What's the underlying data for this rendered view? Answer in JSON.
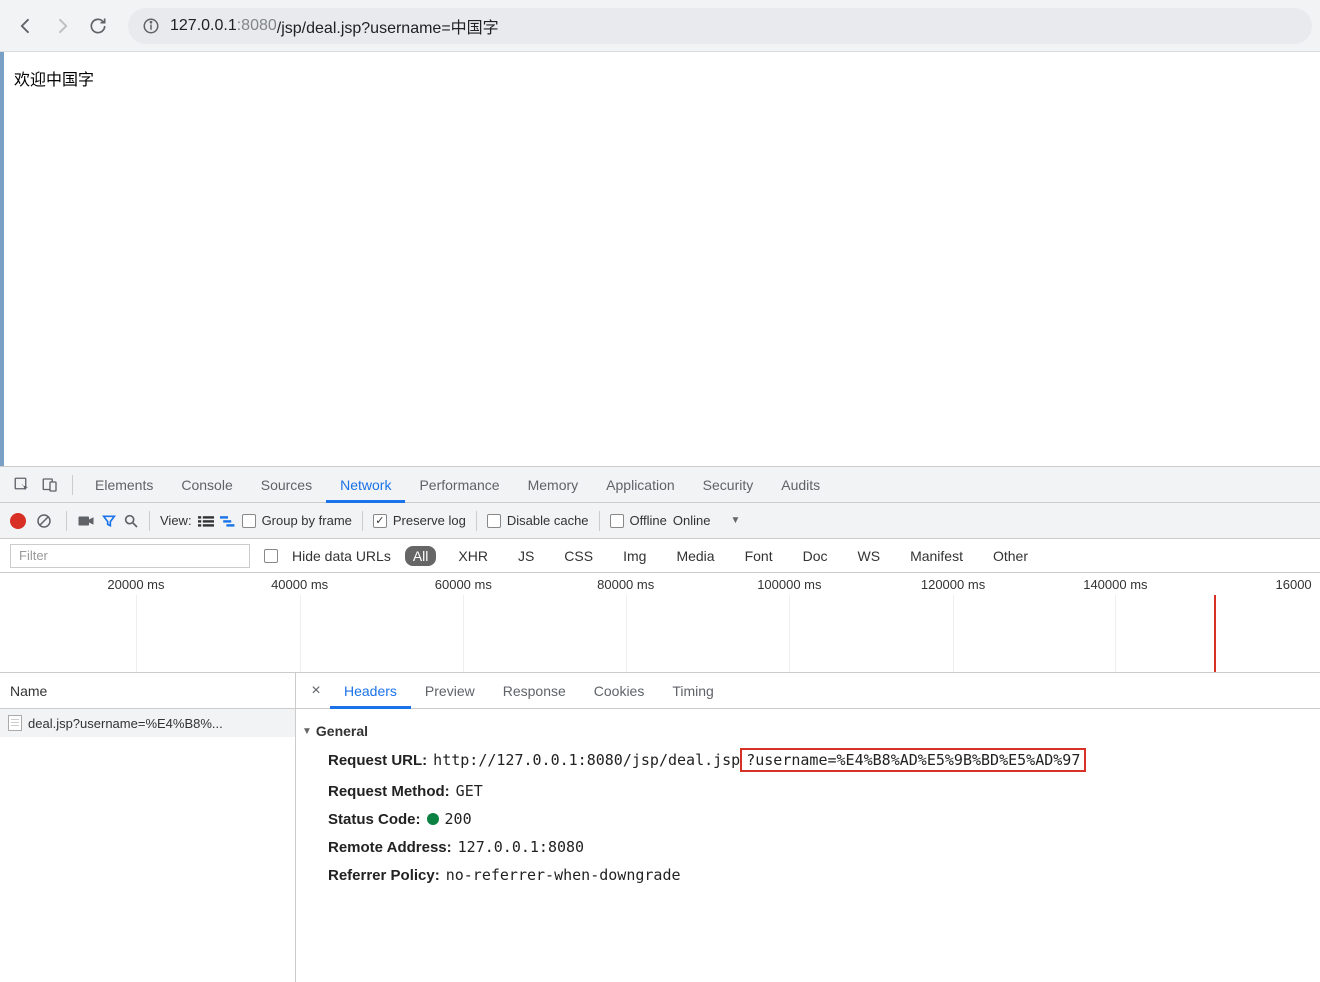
{
  "browser": {
    "url_host": "127.0.0.1",
    "url_port": ":8080",
    "url_path": "/jsp/deal.jsp?username=中国字"
  },
  "page": {
    "body_text": "欢迎中国字"
  },
  "devtools": {
    "tabs": [
      "Elements",
      "Console",
      "Sources",
      "Network",
      "Performance",
      "Memory",
      "Application",
      "Security",
      "Audits"
    ],
    "active_tab": "Network"
  },
  "network_toolbar": {
    "view_label": "View:",
    "group_by_frame": "Group by frame",
    "preserve_log": "Preserve log",
    "disable_cache": "Disable cache",
    "offline": "Offline",
    "online": "Online"
  },
  "filter": {
    "placeholder": "Filter",
    "hide_data_urls": "Hide data URLs",
    "types": [
      "All",
      "XHR",
      "JS",
      "CSS",
      "Img",
      "Media",
      "Font",
      "Doc",
      "WS",
      "Manifest",
      "Other"
    ],
    "active_type": "All"
  },
  "timeline": {
    "ticks": [
      "20000 ms",
      "40000 ms",
      "60000 ms",
      "80000 ms",
      "100000 ms",
      "120000 ms",
      "140000 ms",
      "16000"
    ]
  },
  "request_list": {
    "header": "Name",
    "items": [
      "deal.jsp?username=%E4%B8%..."
    ]
  },
  "detail": {
    "tabs": [
      "Headers",
      "Preview",
      "Response",
      "Cookies",
      "Timing"
    ],
    "active_tab": "Headers",
    "general_title": "General",
    "rows": {
      "request_url_label": "Request URL:",
      "request_url_prefix": "http://127.0.0.1:8080/jsp/deal.jsp",
      "request_url_query": "?username=%E4%B8%AD%E5%9B%BD%E5%AD%97",
      "request_method_label": "Request Method:",
      "request_method_value": "GET",
      "status_code_label": "Status Code:",
      "status_code_value": "200",
      "remote_address_label": "Remote Address:",
      "remote_address_value": "127.0.0.1:8080",
      "referrer_policy_label": "Referrer Policy:",
      "referrer_policy_value": "no-referrer-when-downgrade"
    }
  }
}
